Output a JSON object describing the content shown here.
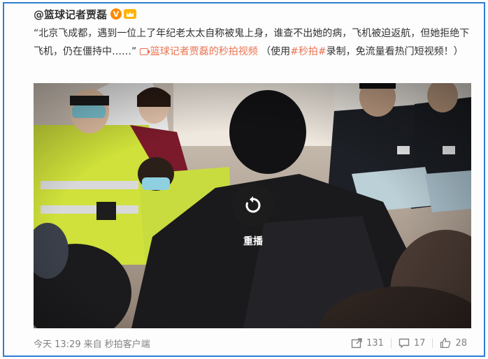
{
  "post": {
    "author": "@篮球记者贾磊",
    "verified_badge": "V",
    "text_main": "“北京飞成都，遇到一位上了年纪老太太自称被鬼上身，谁查不出她的病，飞机被迫返航，但她拒绝下飞机，仍在僵持中……”",
    "video_link_label": "篮球记者贾磊的秒拍视频",
    "text_paren_open": "（使用",
    "hashtag": "#秒拍#",
    "text_paren_close": "录制，免流量看热门短视频！）"
  },
  "video": {
    "replay_label": "重播"
  },
  "footer": {
    "time": "今天 13:29",
    "from_prefix": "来自",
    "source": "秒拍客户端",
    "repost_count": "131",
    "comment_count": "17",
    "like_count": "28"
  },
  "icons": {
    "verified": "verified-v-icon",
    "crown": "crown-badge-icon",
    "video_link": "video-link-icon",
    "replay": "replay-icon",
    "repost": "repost-icon",
    "comment": "comment-icon",
    "like": "like-icon"
  },
  "colors": {
    "link": "#eb7350",
    "frame_border": "#2d7fd4",
    "verified": "#ff8a00"
  }
}
